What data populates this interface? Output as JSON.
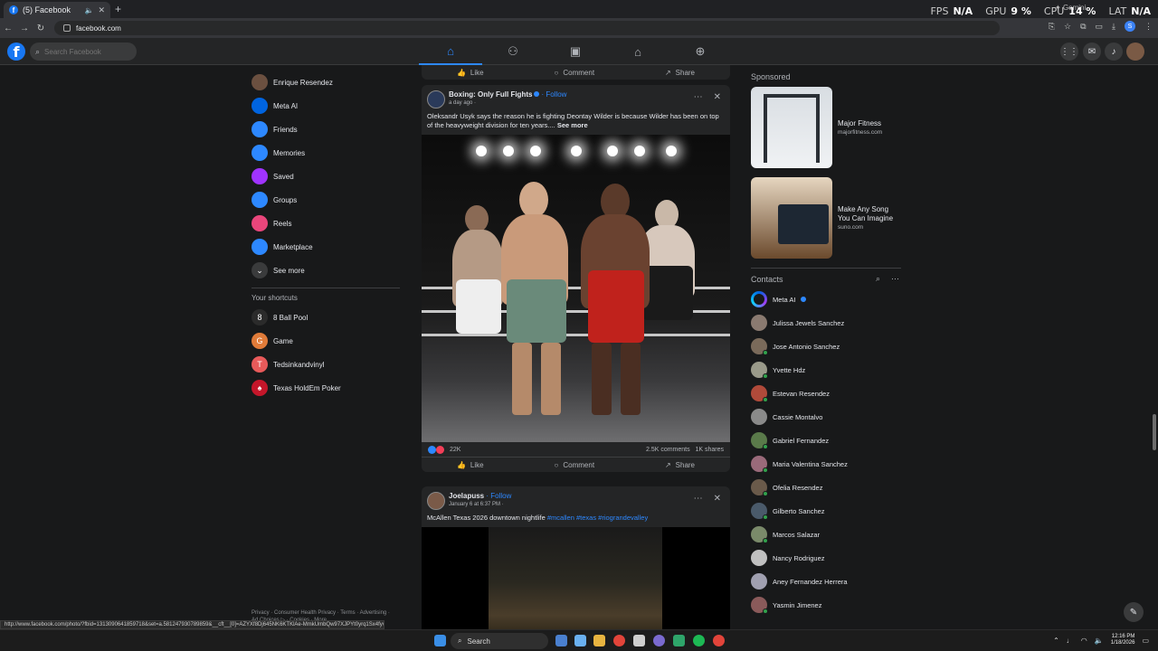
{
  "browser": {
    "tab_title": "(5) Facebook",
    "url": "facebook.com",
    "status_url": "http://www.facebook.com/photo/?fbid=1313090641859718&set=a.581247930789859&__cft__[0]=AZYXf8Dj645NK6KTKlAe-MmkUmbQw97XJPYt0yrq1Sx4fyvat...",
    "overlay": {
      "fps_label": "FPS",
      "fps": "N/A",
      "gpu_label": "GPU",
      "gpu": "9 %",
      "cpu_label": "CPU",
      "cpu": "14 %",
      "lat_label": "LAT",
      "lat": "N/A"
    },
    "gemini_label": "Gemini",
    "profile_initial": "S"
  },
  "fb_header": {
    "logo": "f",
    "search_placeholder": "Search Facebook"
  },
  "sidebar": {
    "items": [
      {
        "label": "Enrique Resendez",
        "icon": "avatar",
        "color": "#6b5040"
      },
      {
        "label": "Meta AI",
        "icon": "meta-ai-icon",
        "color": "#0064e0"
      },
      {
        "label": "Friends",
        "icon": "friends-icon",
        "color": "#2d88ff"
      },
      {
        "label": "Memories",
        "icon": "memories-icon",
        "color": "#2d88ff"
      },
      {
        "label": "Saved",
        "icon": "saved-icon",
        "color": "#a033ff"
      },
      {
        "label": "Groups",
        "icon": "groups-icon",
        "color": "#2d88ff"
      },
      {
        "label": "Reels",
        "icon": "reels-icon",
        "color": "#e9467b"
      },
      {
        "label": "Marketplace",
        "icon": "marketplace-icon",
        "color": "#2d88ff"
      },
      {
        "label": "See more",
        "icon": "chevron-down-icon",
        "color": "#3a3b3c"
      }
    ],
    "shortcuts_heading": "Your shortcuts",
    "shortcuts": [
      {
        "label": "8 Ball Pool",
        "initial": "8",
        "color": "#2b2b2b"
      },
      {
        "label": "Game",
        "initial": "G",
        "color": "#e07b39"
      },
      {
        "label": "Tedsinkandvinyl",
        "initial": "T",
        "color": "#e85a5a"
      },
      {
        "label": "Texas HoldEm Poker",
        "initial": "♠",
        "color": "#c4162a"
      }
    ],
    "footer": "Privacy · Consumer Health Privacy · Terms · Advertising · Ad Choices ▷ · Cookies · More"
  },
  "feed": {
    "top_actions": {
      "like": "Like",
      "comment": "Comment",
      "share": "Share"
    },
    "post1": {
      "author": "Boxing: Only Full Fights",
      "follow": "· Follow",
      "time": "a day ago ·",
      "text": "Oleksandr Usyk says the reason he is fighting Deontay Wilder is because Wilder has been on top of the heavyweight division for ten years....",
      "see_more": "See more",
      "reactions": "22K",
      "comments": "2.5K comments",
      "shares": "1K shares",
      "like": "Like",
      "comment": "Comment",
      "share": "Share"
    },
    "post2": {
      "author": "Joelapuss",
      "follow": "· Follow",
      "time": "January 6 at 6:37 PM ·",
      "text": "McAllen Texas 2026 downtown nightlife",
      "tags": "#mcallen #texas #riograndevalley"
    }
  },
  "right": {
    "sponsored_heading": "Sponsored",
    "ads": [
      {
        "title": "Major Fitness",
        "site": "majorfitness.com"
      },
      {
        "title": "Make Any Song You Can Imagine",
        "site": "suno.com"
      }
    ],
    "contacts_heading": "Contacts",
    "contacts": [
      {
        "name": "Meta AI",
        "color": "meta",
        "online": false
      },
      {
        "name": "Julissa Jewels Sanchez",
        "color": "#8a7a70",
        "online": false
      },
      {
        "name": "Jose Antonio Sanchez",
        "color": "#7a6a5a",
        "online": true
      },
      {
        "name": "Yvette Hdz",
        "color": "#9a9a8a",
        "online": true
      },
      {
        "name": "Estevan Resendez",
        "color": "#b04a3a",
        "online": true
      },
      {
        "name": "Cassie Montalvo",
        "color": "#8a8a8a",
        "online": false
      },
      {
        "name": "Gabriel Fernandez",
        "color": "#5a7a4a",
        "online": true
      },
      {
        "name": "Maria Valentina Sanchez",
        "color": "#9a6a7a",
        "online": true
      },
      {
        "name": "Ofelia Resendez",
        "color": "#6a5a4a",
        "online": true
      },
      {
        "name": "Gilberto Sanchez",
        "color": "#4a5a6a",
        "online": true
      },
      {
        "name": "Marcos Salazar",
        "color": "#7a8a6a",
        "online": true
      },
      {
        "name": "Nancy Rodriguez",
        "color": "#c0c0c0",
        "online": false
      },
      {
        "name": "Aney Fernandez Herrera",
        "color": "#a0a0b0",
        "online": false
      },
      {
        "name": "Yasmin Jimenez",
        "color": "#8a5a5a",
        "online": true
      }
    ]
  },
  "taskbar": {
    "search_label": "Search",
    "time": "12:16 PM",
    "date": "1/18/2026"
  }
}
